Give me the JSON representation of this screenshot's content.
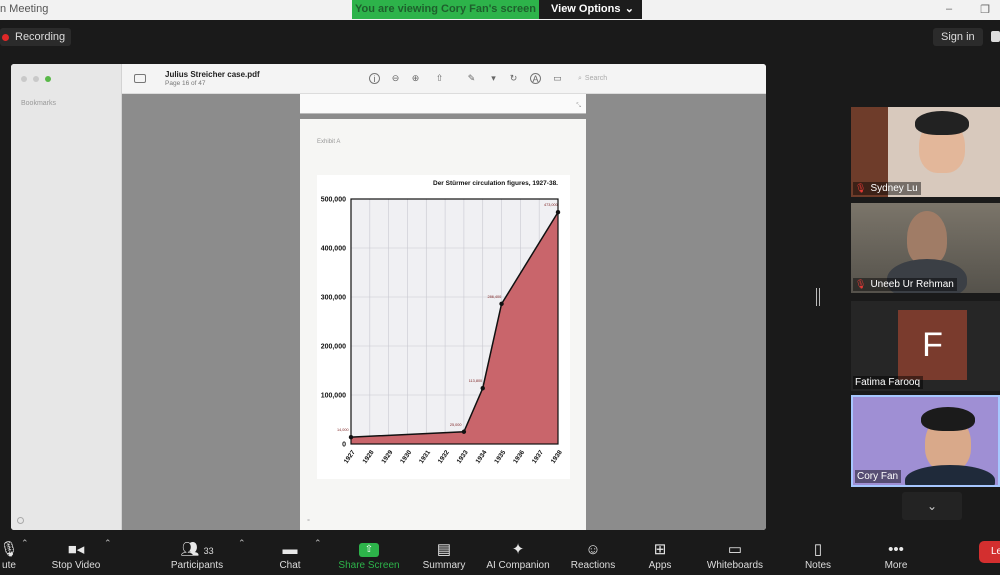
{
  "window": {
    "title": "n Meeting",
    "banner_text": "You are viewing Cory Fan's screen",
    "view_options_label": "View Options",
    "view_options_chevron": "⌄"
  },
  "header": {
    "recording_label": "Recording",
    "signin_label": "Sign in"
  },
  "pdf_viewer": {
    "document_title": "Julius Streicher case.pdf",
    "page_indicator": "Page 16 of 47",
    "sidebar_heading": "Bookmarks",
    "search_placeholder": "Search",
    "page_label": "Exhibit A"
  },
  "chart_data": {
    "type": "area",
    "title": "Der Stürmer circulation figures, 1927-38.",
    "x": [
      1927,
      1928,
      1929,
      1930,
      1931,
      1932,
      1933,
      1934,
      1935,
      1936,
      1937,
      1938
    ],
    "x_tick_labels": [
      "1927",
      "1928",
      "1929",
      "1930",
      "1931",
      "1932",
      "1933",
      "1934",
      "1935",
      "1936",
      "1937",
      "1938"
    ],
    "points": [
      {
        "x": 1927,
        "y": 14000,
        "label": "14,000"
      },
      {
        "x": 1933,
        "y": 25000,
        "label": "25,000"
      },
      {
        "x": 1934,
        "y": 113800,
        "label": "113,800"
      },
      {
        "x": 1935,
        "y": 286000,
        "label": "286,400"
      },
      {
        "x": 1938,
        "y": 473000,
        "label": "473,000"
      }
    ],
    "y_tick_labels": [
      "0",
      "100,000",
      "200,000",
      "300,000",
      "400,000",
      "500,000"
    ],
    "y_ticks": [
      0,
      100000,
      200000,
      300000,
      400000,
      500000
    ],
    "ylim": [
      0,
      500000
    ],
    "xlim": [
      1927,
      1938
    ],
    "grid": true,
    "fill_color": "#c9656b",
    "line_color": "#111111"
  },
  "participants": [
    {
      "name": "Sydney Lu",
      "muted": true
    },
    {
      "name": "Uneeb Ur Rehman",
      "muted": true
    },
    {
      "name": "Fatima Farooq",
      "muted": false,
      "initial": "F"
    },
    {
      "name": "Cory Fan",
      "muted": false
    }
  ],
  "toolbar": {
    "mute_label": "ute",
    "stop_video_label": "Stop Video",
    "participants_label": "Participants",
    "participants_count": "33",
    "chat_label": "Chat",
    "share_screen_label": "Share Screen",
    "summary_label": "Summary",
    "ai_companion_label": "AI Companion",
    "reactions_label": "Reactions",
    "apps_label": "Apps",
    "whiteboards_label": "Whiteboards",
    "notes_label": "Notes",
    "more_label": "More",
    "leave_label": "Le"
  },
  "colors": {
    "share_green": "#2db34a",
    "leave_red": "#d32f2f",
    "background": "#1a1a1a"
  }
}
